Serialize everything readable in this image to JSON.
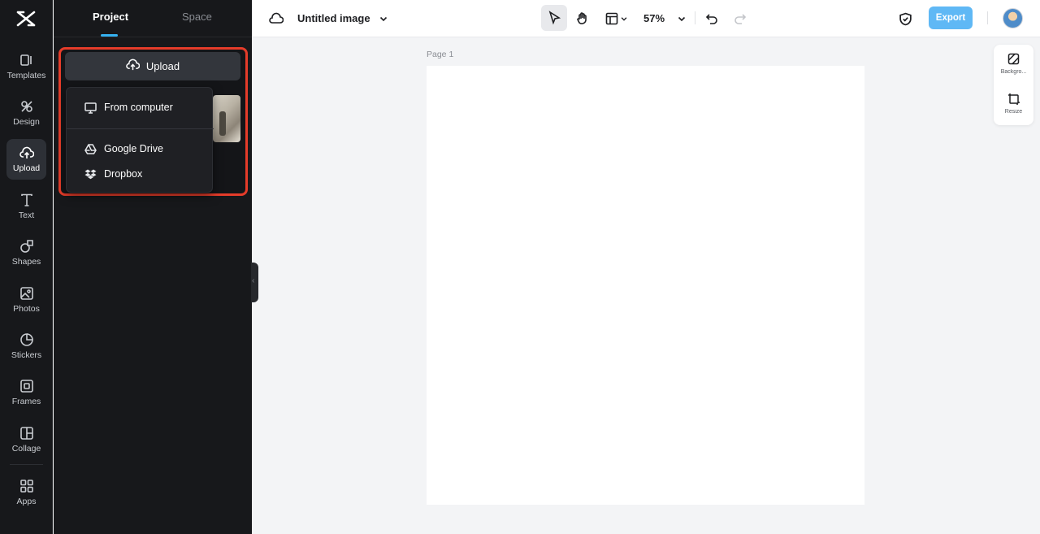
{
  "rail": {
    "items": [
      {
        "label": "Templates",
        "icon": "templates-icon"
      },
      {
        "label": "Design",
        "icon": "design-icon"
      },
      {
        "label": "Upload",
        "icon": "upload-cloud-icon",
        "active": true
      },
      {
        "label": "Text",
        "icon": "text-icon"
      },
      {
        "label": "Shapes",
        "icon": "shapes-icon"
      },
      {
        "label": "Photos",
        "icon": "photos-icon"
      },
      {
        "label": "Stickers",
        "icon": "stickers-icon"
      },
      {
        "label": "Frames",
        "icon": "frames-icon"
      },
      {
        "label": "Collage",
        "icon": "collage-icon"
      },
      {
        "label": "Apps",
        "icon": "apps-icon"
      }
    ]
  },
  "panel": {
    "tabs": [
      {
        "label": "Project",
        "active": true
      },
      {
        "label": "Space",
        "active": false
      }
    ],
    "upload_label": "Upload",
    "menu": {
      "items": [
        {
          "label": "From computer",
          "icon": "monitor-icon"
        },
        {
          "label": "Google Drive",
          "icon": "google-drive-icon"
        },
        {
          "label": "Dropbox",
          "icon": "dropbox-icon"
        }
      ]
    }
  },
  "topbar": {
    "title": "Untitled image",
    "zoom": "57%",
    "export_label": "Export"
  },
  "canvas": {
    "page_label": "Page 1"
  },
  "right_panel": {
    "items": [
      {
        "label": "Backgro...",
        "icon": "background-icon"
      },
      {
        "label": "Resize",
        "icon": "resize-icon"
      }
    ]
  },
  "colors": {
    "accent": "#35b1f0",
    "export": "#5fb8f5",
    "highlight": "#e53c2a",
    "sidebar_bg": "#17181b"
  }
}
